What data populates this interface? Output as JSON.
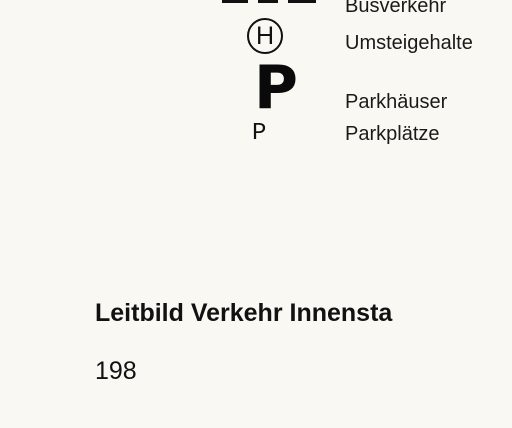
{
  "legend": {
    "bus": {
      "icon": "bus-route-dashed-line-icon",
      "label": "Busverkehr"
    },
    "transfer": {
      "icon": "transfer-stop-h-circle-icon",
      "symbol": "H",
      "label": "Umsteigehalte"
    },
    "parking_garage": {
      "icon": "parking-garage-bold-p-icon",
      "symbol": "P",
      "label": "Parkhäuser"
    },
    "parking_lot": {
      "icon": "parking-lot-thin-p-icon",
      "symbol": "P",
      "label": "Parkplätze"
    }
  },
  "title": "Leitbild Verkehr Innensta",
  "page_number": "198"
}
